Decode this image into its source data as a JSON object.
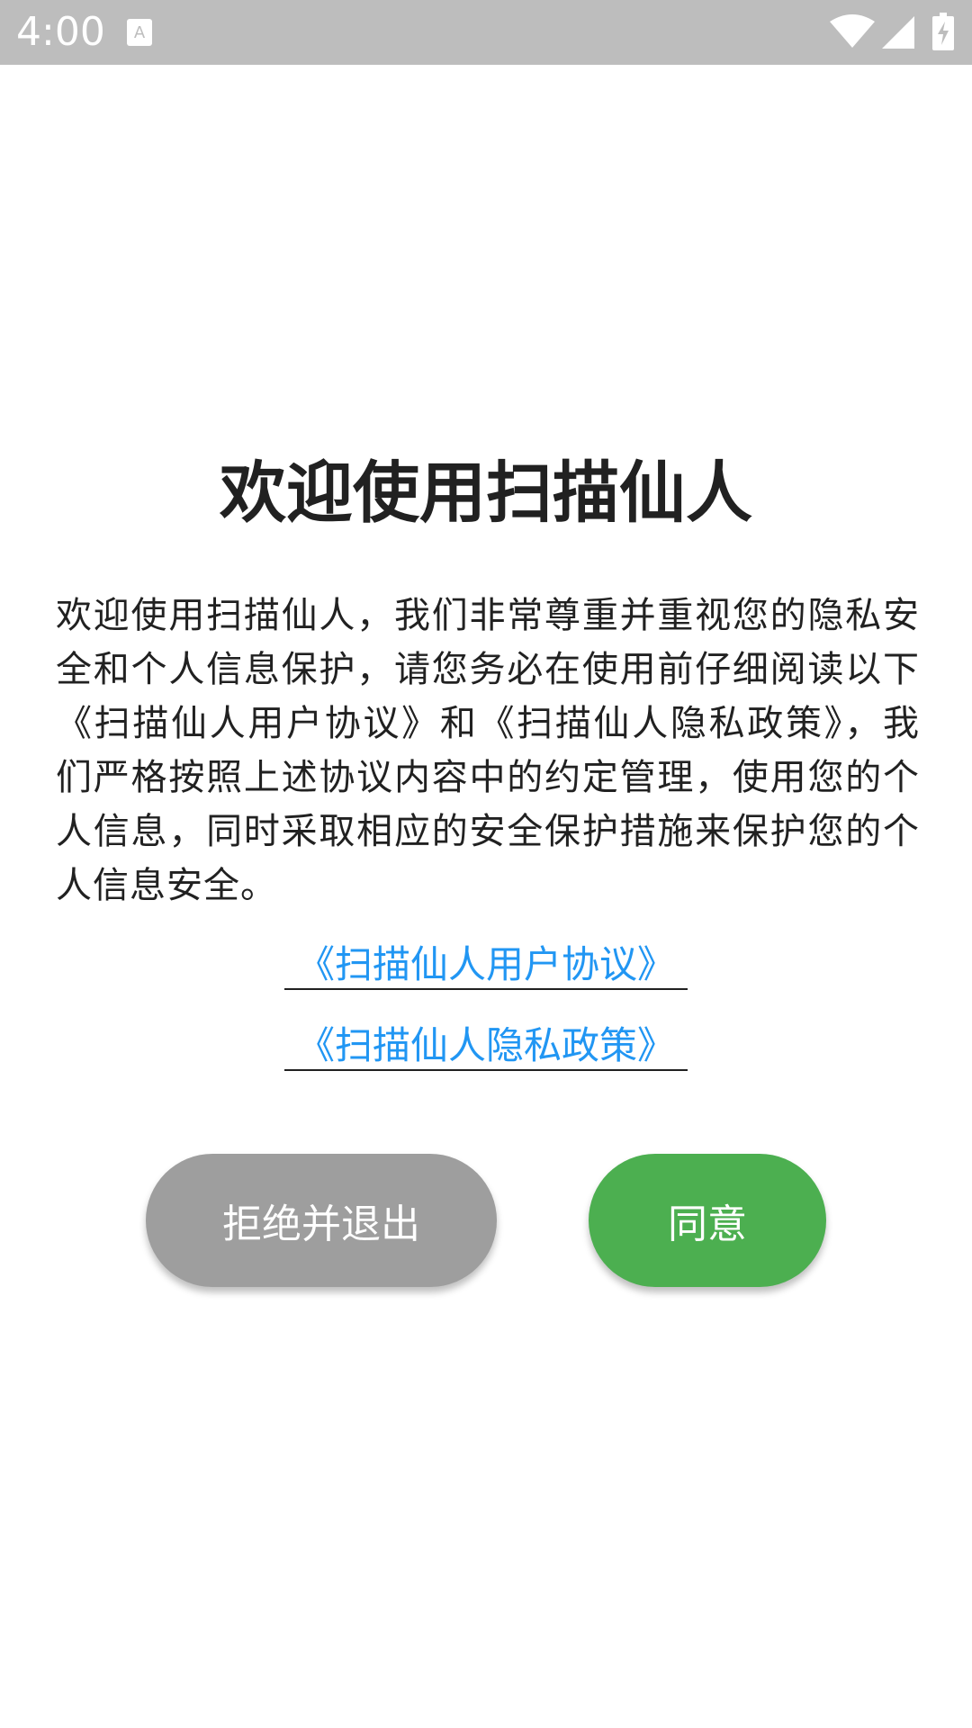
{
  "status_bar": {
    "time": "4:00",
    "icons": [
      "a-notification-icon",
      "wifi-icon",
      "signal-icon",
      "battery-charging-icon"
    ]
  },
  "dialog": {
    "title": "欢迎使用扫描仙人",
    "body": "欢迎使用扫描仙人，我们非常尊重并重视您的隐私安全和个人信息保护，请您务必在使用前仔细阅读以下《扫描仙人用户协议》和《扫描仙人隐私政策》，我们严格按照上述协议内容中的约定管理，使用您的个人信息，同时采取相应的安全保护措施来保护您的个人信息安全。",
    "link_user_agreement": "《扫描仙人用户协议》",
    "link_privacy_policy": "《扫描仙人隐私政策》",
    "reject_label": "拒绝并退出",
    "agree_label": "同意"
  },
  "colors": {
    "status_bar": "#bdbdbd",
    "link": "#2196f3",
    "reject_button": "#9e9e9e",
    "agree_button": "#4caf50",
    "text": "#212121"
  }
}
